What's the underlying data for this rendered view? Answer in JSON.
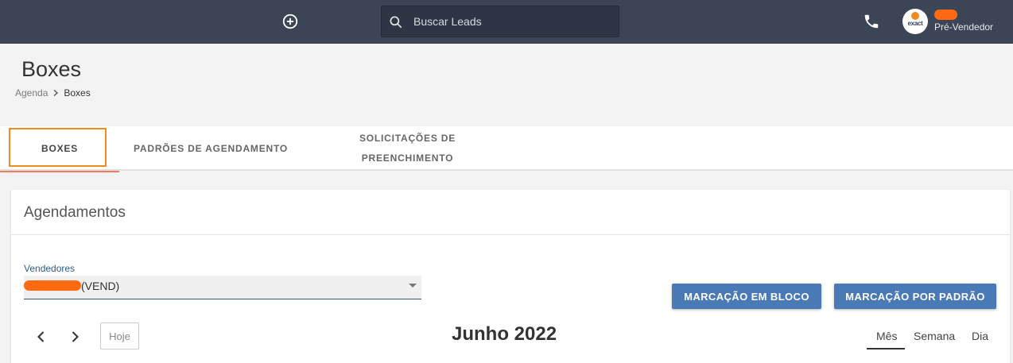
{
  "topbar": {
    "search_placeholder": "Buscar Leads",
    "user_role": "Pré-Vendedor",
    "avatar_logo_text": "exact"
  },
  "page": {
    "title": "Boxes",
    "breadcrumb": [
      "Agenda",
      "Boxes"
    ]
  },
  "tabs": [
    {
      "label": "BOXES",
      "active": true
    },
    {
      "label": "PADRÕES DE AGENDAMENTO"
    },
    {
      "label": "SOLICITAÇÕES DE PREENCHIMENTO"
    }
  ],
  "card": {
    "title": "Agendamentos",
    "vendedores_label": "Vendedores",
    "vendedor_value": "(VEND)",
    "btn_bloco": "MARCAÇÃO EM BLOCO",
    "btn_padrao": "MARCAÇÃO POR PADRÃO",
    "today_label": "Hoje",
    "month_title": "Junho 2022",
    "views": [
      "Mês",
      "Semana",
      "Dia"
    ],
    "active_view": "Mês"
  },
  "colors": {
    "topbar": "#3b4556",
    "accent_blue": "#4a7ab5",
    "highlight_orange": "#f08c1f",
    "redaction": "#ff6a13"
  },
  "icons": [
    "add-circle-icon",
    "search-icon",
    "phone-icon",
    "chevron-left-icon",
    "chevron-right-icon",
    "caret-down-icon"
  ]
}
